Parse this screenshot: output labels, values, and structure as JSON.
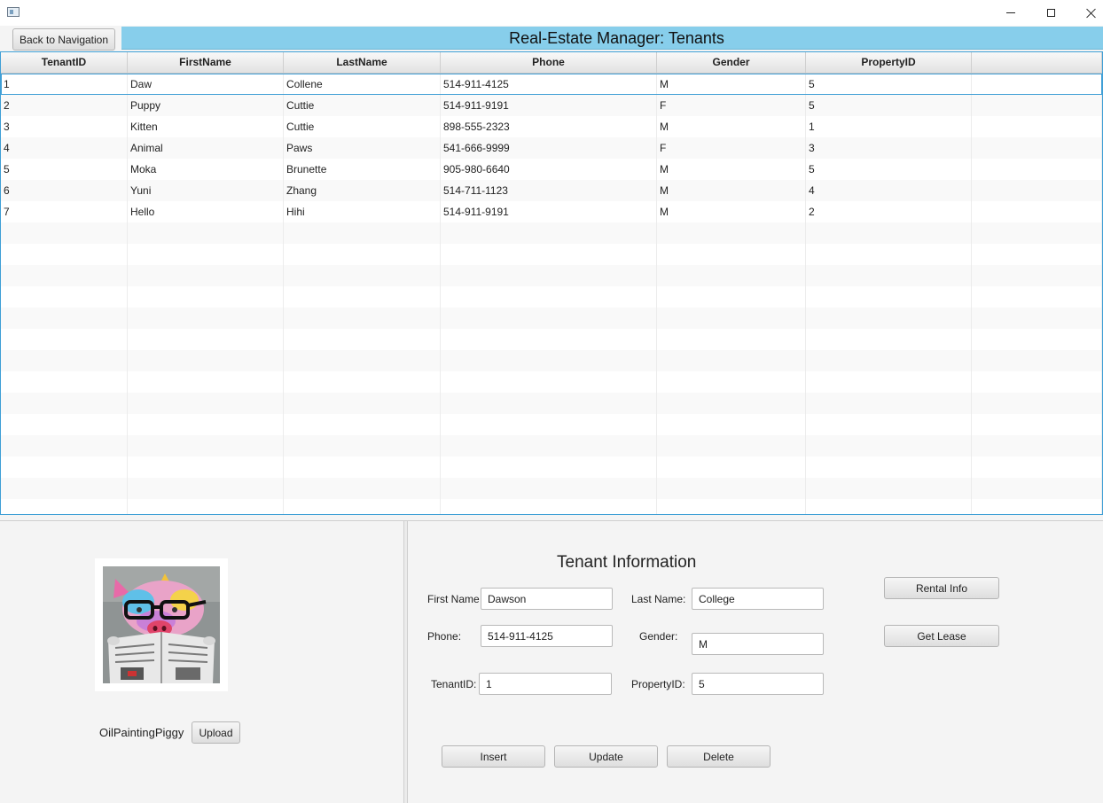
{
  "header": {
    "back_button_label": "Back to Navigation",
    "title": "Real-Estate Manager: Tenants",
    "band_color": "#87CEEB"
  },
  "table": {
    "columns": [
      "TenantID",
      "FirstName",
      "LastName",
      "Phone",
      "Gender",
      "PropertyID",
      ""
    ],
    "rows": [
      [
        "1",
        "Daw",
        "Collene",
        "514-911-4125",
        "M",
        "5",
        ""
      ],
      [
        "2",
        "Puppy",
        "Cuttie",
        "514-911-9191",
        "F",
        "5",
        ""
      ],
      [
        "3",
        "Kitten",
        "Cuttie",
        "898-555-2323",
        "M",
        "1",
        ""
      ],
      [
        "4",
        "Animal",
        "Paws",
        "541-666-9999",
        "F",
        "3",
        ""
      ],
      [
        "5",
        "Moka",
        "Brunette",
        "905-980-6640",
        "M",
        "5",
        ""
      ],
      [
        "6",
        "Yuni",
        "Zhang",
        "514-711-1123",
        "M",
        "4",
        ""
      ],
      [
        "7",
        "Hello",
        "Hihi",
        "514-911-9191",
        "M",
        "2",
        ""
      ],
      [
        "",
        "",
        "",
        "",
        "",
        "",
        ""
      ],
      [
        "",
        "",
        "",
        "",
        "",
        "",
        ""
      ],
      [
        "",
        "",
        "",
        "",
        "",
        "",
        ""
      ],
      [
        "",
        "",
        "",
        "",
        "",
        "",
        ""
      ],
      [
        "",
        "",
        "",
        "",
        "",
        "",
        ""
      ],
      [
        "",
        "",
        "",
        "",
        "",
        "",
        ""
      ],
      [
        "",
        "",
        "",
        "",
        "",
        "",
        ""
      ],
      [
        "",
        "",
        "",
        "",
        "",
        "",
        ""
      ],
      [
        "",
        "",
        "",
        "",
        "",
        "",
        ""
      ],
      [
        "",
        "",
        "",
        "",
        "",
        "",
        ""
      ],
      [
        "",
        "",
        "",
        "",
        "",
        "",
        ""
      ],
      [
        "",
        "",
        "",
        "",
        "",
        "",
        ""
      ],
      [
        "",
        "",
        "",
        "",
        "",
        "",
        ""
      ],
      [
        "",
        "",
        "",
        "",
        "",
        "",
        ""
      ]
    ],
    "selected_row": 0
  },
  "photo": {
    "caption": "OilPaintingPiggy",
    "upload_label": "Upload",
    "image_icon": "pig-with-glasses-reading-newspaper-painting"
  },
  "form": {
    "title": "Tenant Information",
    "first_name_label": "First Name",
    "first_name_value": "Dawson",
    "last_name_label": "Last Name:",
    "last_name_value": "College",
    "phone_label": "Phone:",
    "phone_value": "514-911-4125",
    "gender_label": "Gender:",
    "gender_value": "M",
    "tenant_id_label": "TenantID:",
    "tenant_id_value": "1",
    "property_id_label": "PropertyID:",
    "property_id_value": "5",
    "rental_info_label": "Rental Info",
    "get_lease_label": "Get Lease",
    "insert_label": "Insert",
    "update_label": "Update",
    "delete_label": "Delete"
  }
}
